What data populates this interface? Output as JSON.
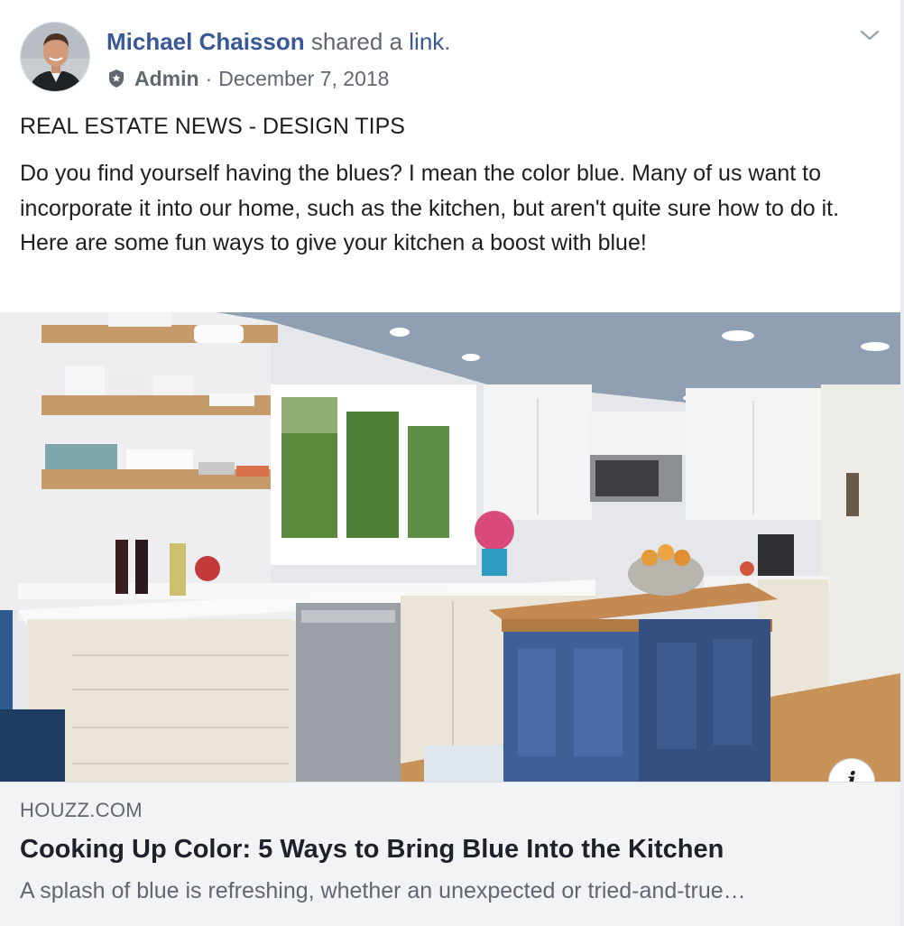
{
  "post": {
    "author": "Michael Chaisson",
    "action_text": " shared a ",
    "action_link": "link",
    "action_end": ".",
    "role": "Admin",
    "separator": "·",
    "date": "December 7, 2018",
    "category": "REAL ESTATE NEWS - DESIGN TIPS",
    "body": "Do you find yourself having the blues? I mean the color blue. Many of us want to incorporate it into our home, such as the kitchen, but aren't quite sure how to do it. Here are some fun ways to give your kitchen a boost with blue!"
  },
  "icons": {
    "badge": "admin-badge-icon",
    "menu": "chevron-down-icon",
    "info": "info-icon"
  },
  "link_preview": {
    "info_glyph": "i",
    "domain": "HOUZZ.COM",
    "title": "Cooking Up Color: 5 Ways to Bring Blue Into the Kitchen",
    "description": "A splash of blue is refreshing, whether an unexpected or tried-and-true…"
  },
  "colors": {
    "link_blue": "#385898",
    "secondary_text": "#606770",
    "preview_bg": "#f2f3f5",
    "island_blue": "#3f5f97"
  }
}
